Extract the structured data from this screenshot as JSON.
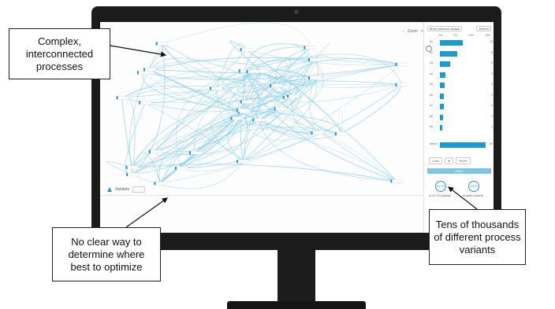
{
  "graph": {
    "zoom_minus": "−",
    "zoom_label": "Zoom",
    "zoom_plus": "+",
    "legend_label": "Variants",
    "line_color": "#8fd0ea",
    "node_color": "#2a95c9"
  },
  "panel": {
    "dropdown": "Most common variant",
    "search": "Search",
    "scale": [
      "0%",
      "5%",
      "10%",
      "15%"
    ],
    "rows": [
      {
        "label": "#1",
        "fraction": 0.5,
        "value": "13"
      },
      {
        "label": "#2",
        "fraction": 0.38,
        "value": "8"
      },
      {
        "label": "#3",
        "fraction": 0.22,
        "value": "5"
      },
      {
        "label": "#4",
        "fraction": 0.12,
        "value": "3"
      },
      {
        "label": "#5",
        "fraction": 0.1,
        "value": "2"
      },
      {
        "label": "#6",
        "fraction": 0.09,
        "value": "2"
      },
      {
        "label": "#7",
        "fraction": 0.08,
        "value": "2"
      },
      {
        "label": "#8",
        "fraction": 0.07,
        "value": "1"
      },
      {
        "label": "#9",
        "fraction": 0.06,
        "value": "1"
      },
      {
        "label": "others",
        "fraction": 1.0,
        "value": "64"
      }
    ],
    "bar_color": "#1a9bd2",
    "control_left": "Load",
    "control_mid": "⊗",
    "control_right": "Reset",
    "apply": "Filter",
    "stat1_value": "12 / 59",
    "stat1_caption": "of 15,724 variants",
    "stat2_value": "100%",
    "stat2_caption": "of cases covered"
  },
  "callouts": {
    "top_left": "Complex,\ninterconnected\nprocesses",
    "bottom_left": "No clear way to\ndetermine where\nbest to optimize",
    "bottom_right": "Tens of thousands\nof different process\nvariants"
  }
}
